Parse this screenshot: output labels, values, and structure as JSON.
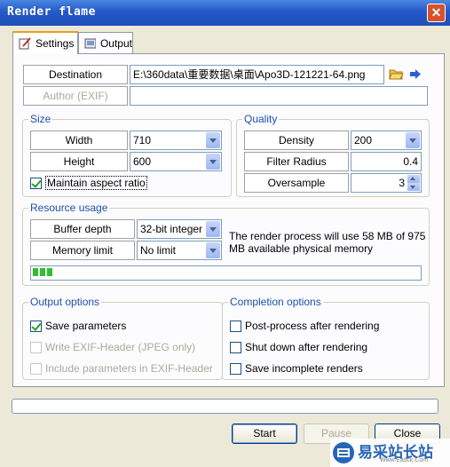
{
  "window": {
    "title": "Render flame",
    "close_icon": "close-icon"
  },
  "tabs": [
    {
      "label": "Settings",
      "icon": "settings-icon",
      "active": true
    },
    {
      "label": "Output",
      "icon": "output-icon",
      "active": false
    }
  ],
  "destination": {
    "label": "Destination",
    "value": "E:\\360data\\重要数据\\桌面\\Apo3D-121221-64.png"
  },
  "author": {
    "label": "Author (EXIF)",
    "value": ""
  },
  "size": {
    "title": "Size",
    "width_label": "Width",
    "width_value": "710",
    "height_label": "Height",
    "height_value": "600",
    "maintain_label": "Maintain aspect ratio",
    "maintain_checked": true
  },
  "quality": {
    "title": "Quality",
    "density_label": "Density",
    "density_value": "200",
    "filter_label": "Filter Radius",
    "filter_value": "0.4",
    "oversample_label": "Oversample",
    "oversample_value": "3"
  },
  "resource": {
    "title": "Resource usage",
    "buffer_label": "Buffer depth",
    "buffer_value": "32-bit integer",
    "memory_label": "Memory limit",
    "memory_value": "No limit",
    "info_text": "The render process will use 58 MB of 975 MB available physical memory",
    "memory_bar_fraction": 0.06
  },
  "output_options": {
    "title": "Output options",
    "save_params": "Save parameters",
    "write_exif": "Write EXIF-Header (JPEG only)",
    "include_params": "Include parameters in EXIF-Header"
  },
  "completion_options": {
    "title": "Completion options",
    "post_process": "Post-process after rendering",
    "shutdown": "Shut down after rendering",
    "save_incomplete": "Save incomplete renders"
  },
  "progress": {
    "fraction": 0
  },
  "buttons": {
    "start": "Start",
    "pause": "Pause",
    "close": "Close"
  },
  "watermark": {
    "text": "易采站长站",
    "subtext": "Www.Easck.Com"
  }
}
